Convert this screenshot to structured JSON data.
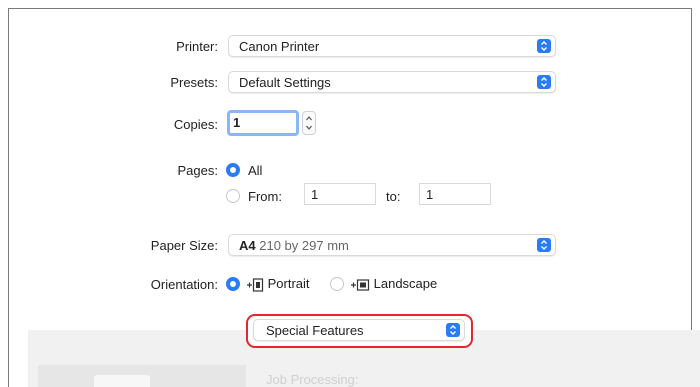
{
  "printer": {
    "label": "Printer:",
    "value": "Canon Printer"
  },
  "presets": {
    "label": "Presets:",
    "value": "Default Settings"
  },
  "copies": {
    "label": "Copies:",
    "value": "1"
  },
  "pages": {
    "label": "Pages:",
    "all_label": "All",
    "from_label": "From:",
    "from_value": "1",
    "to_label": "to:",
    "to_value": "1"
  },
  "paper_size": {
    "label": "Paper Size:",
    "value_bold": "A4",
    "value_detail": "210 by 297 mm"
  },
  "orientation": {
    "label": "Orientation:",
    "portrait": "Portrait",
    "landscape": "Landscape"
  },
  "section_menu": {
    "value": "Special Features"
  },
  "job_processing": {
    "label": "Job Processing:"
  },
  "colors": {
    "accent": "#2a7cf6",
    "highlight": "#e0282e"
  }
}
